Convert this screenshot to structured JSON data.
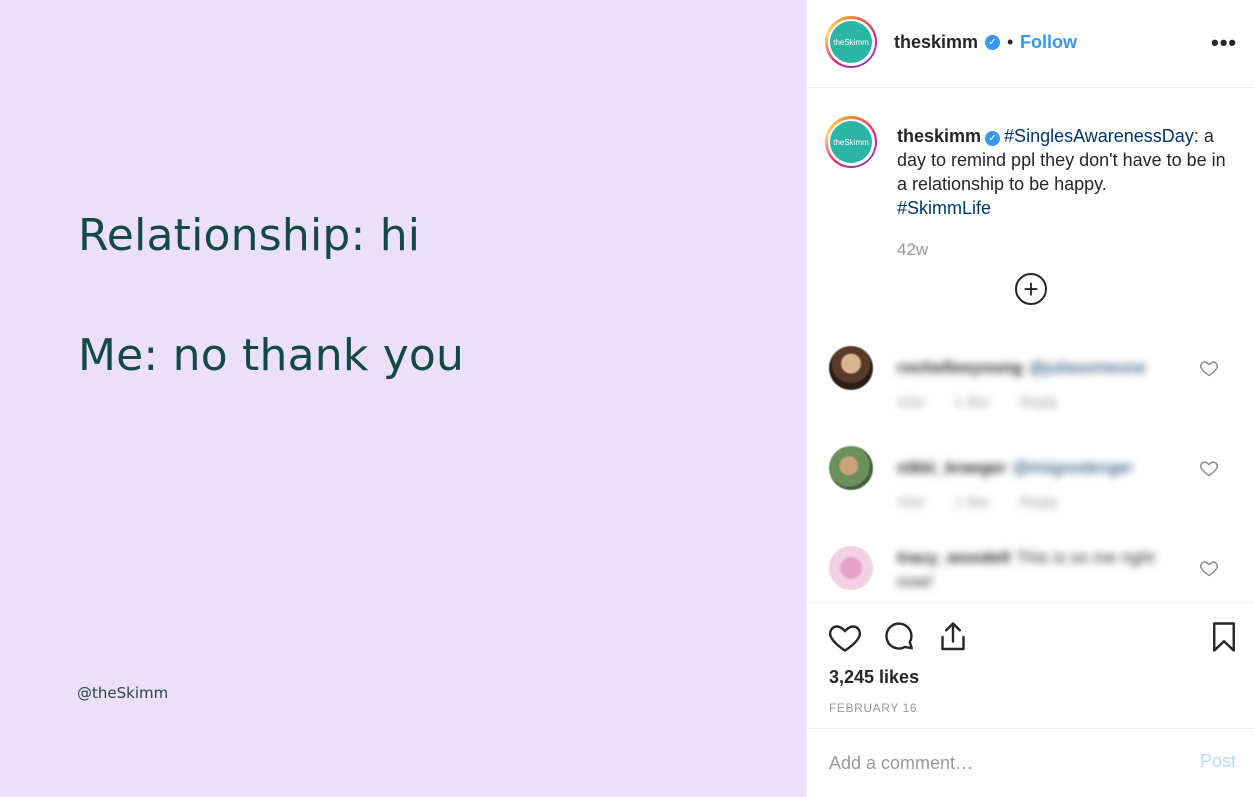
{
  "post_image": {
    "line1": "Relationship: hi",
    "line2": "Me: no thank you",
    "handle": "@theSkimm",
    "background": "#ecdffb",
    "text_color": "#144a45"
  },
  "header": {
    "avatar_text": "theSkimm",
    "username": "theskimm",
    "verified_icon": "✓",
    "separator": "•",
    "follow_label": "Follow",
    "more_label": "•••"
  },
  "caption": {
    "avatar_text": "theSkimm",
    "username": "theskimm",
    "verified_icon": "✓",
    "hashtag1": "#SinglesAwarenessDay",
    "text": ": a day to remind ppl they don't have to be in a relationship to be happy.",
    "hashtag2": "#SkimmLife",
    "time_ago": "42w",
    "load_more": "+"
  },
  "comments": [
    {
      "user": "rochelleeyoung",
      "text": "@juliasomeone",
      "meta": [
        "42w",
        "1 like",
        "Reply"
      ]
    },
    {
      "user": "nikki_kraeger",
      "text": "@imigoodenger",
      "meta": [
        "42w",
        "1 like",
        "Reply"
      ]
    },
    {
      "user": "tracy_woodell",
      "text": "This is so me right now!",
      "meta": []
    }
  ],
  "actions": {
    "likes": "3,245 likes",
    "date": "FEBRUARY 16"
  },
  "comment_box": {
    "placeholder": "Add a comment…",
    "post_label": "Post"
  },
  "colors": {
    "accent": "#3897f0",
    "hashtag": "#003569",
    "muted": "#999999",
    "brand_teal": "#2bb5a5"
  }
}
